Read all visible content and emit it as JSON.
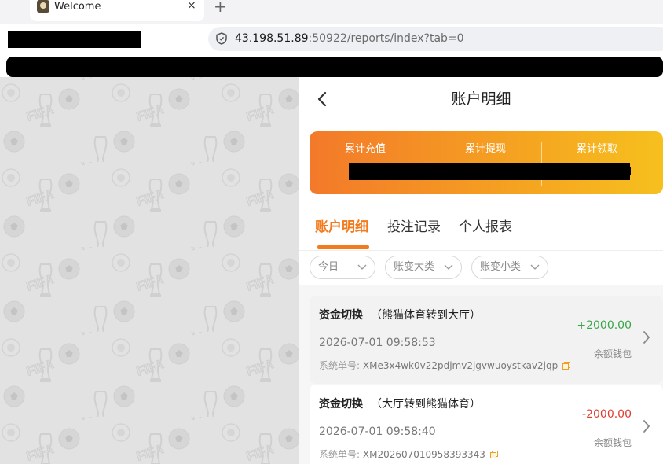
{
  "browser": {
    "tab_title": "Welcome",
    "tab_close": "×",
    "new_tab": "+",
    "url_host": "43.198.51.89",
    "url_rest": ":50922/reports/index?tab=0"
  },
  "header": {
    "title": "账户明细"
  },
  "summary": {
    "items": [
      {
        "label": "累计充值"
      },
      {
        "label": "累计提现"
      },
      {
        "label": "累计领取"
      }
    ]
  },
  "tabs": [
    {
      "label": "账户明细",
      "active": true
    },
    {
      "label": "投注记录",
      "active": false
    },
    {
      "label": "个人报表",
      "active": false
    }
  ],
  "filters": [
    {
      "label": "今日"
    },
    {
      "label": "账变大类"
    },
    {
      "label": "账变小类"
    }
  ],
  "records": [
    {
      "type": "资金切换",
      "detail": "（熊猫体育转到大厅）",
      "time": "2026-07-01 09:58:53",
      "order_label": "系统单号:",
      "order_no": "XMe3x4wk0v22pdjmv2jgvwuoystkav2jqp",
      "amount": "+2000.00",
      "wallet": "余额钱包"
    },
    {
      "type": "资金切换",
      "detail": "（大厅转到熊猫体育）",
      "time": "2026-07-01 09:58:40",
      "order_label": "系统单号:",
      "order_no": "XM20260701095839334​3",
      "amount": "-2000.00",
      "wallet": "余额钱包"
    }
  ],
  "colors": {
    "accent": "#f37b1d",
    "positive": "#3aa64a",
    "negative": "#e03c32"
  }
}
